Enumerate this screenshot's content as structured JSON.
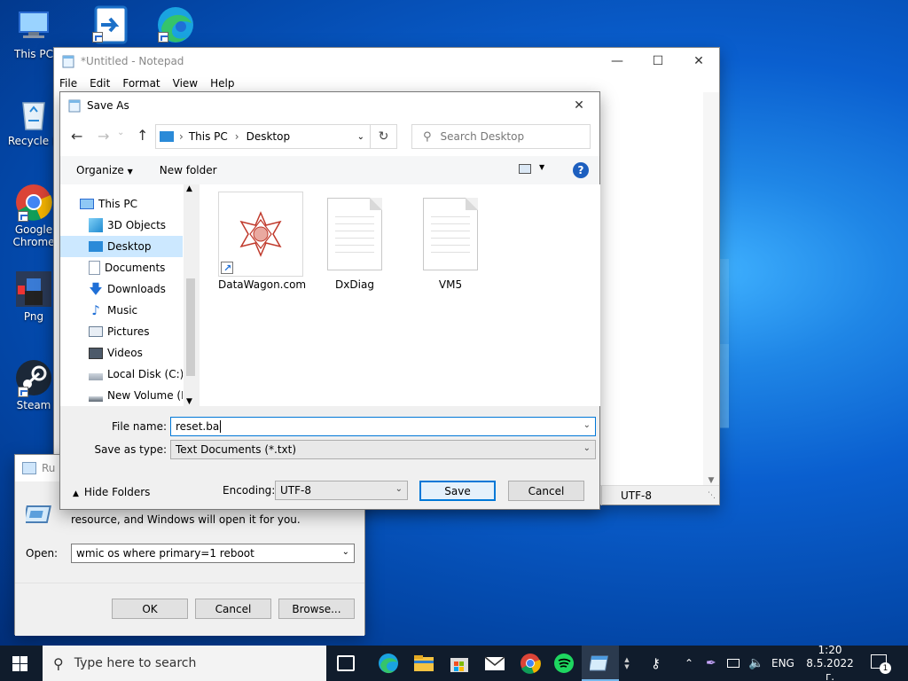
{
  "desktop": {
    "icons": [
      {
        "label": "This PC"
      },
      {
        "label": "Recycle B"
      },
      {
        "label": "Google Chrome"
      },
      {
        "label": "Png"
      },
      {
        "label": "Steam"
      }
    ]
  },
  "notepad": {
    "title": "*Untitled - Notepad",
    "menu": [
      "File",
      "Edit",
      "Format",
      "View",
      "Help"
    ],
    "status_encoding": "UTF-8"
  },
  "run": {
    "title": "Ru",
    "description": "resource, and Windows will open it for you.",
    "open_label": "Open:",
    "open_value": "wmic os where primary=1 reboot",
    "ok": "OK",
    "cancel": "Cancel",
    "browse": "Browse..."
  },
  "saveas": {
    "title": "Save As",
    "breadcrumb": [
      "This PC",
      "Desktop"
    ],
    "search_placeholder": "Search Desktop",
    "organize": "Organize",
    "new_folder": "New folder",
    "nav": [
      {
        "label": "This PC"
      },
      {
        "label": "3D Objects"
      },
      {
        "label": "Desktop"
      },
      {
        "label": "Documents"
      },
      {
        "label": "Downloads"
      },
      {
        "label": "Music"
      },
      {
        "label": "Pictures"
      },
      {
        "label": "Videos"
      },
      {
        "label": "Local Disk (C:)"
      },
      {
        "label": "New Volume (D:"
      }
    ],
    "files": [
      {
        "name": "DataWagon.com"
      },
      {
        "name": "DxDiag"
      },
      {
        "name": "VM5"
      }
    ],
    "file_name_label": "File name:",
    "file_name_value": "reset.ba",
    "save_type_label": "Save as type:",
    "save_type_value": "Text Documents (*.txt)",
    "hide_folders": "Hide Folders",
    "encoding_label": "Encoding:",
    "encoding_value": "UTF-8",
    "save": "Save",
    "cancel": "Cancel"
  },
  "taskbar": {
    "search_placeholder": "Type here to search",
    "lang": "ENG",
    "time": "1:20",
    "date": "8.5.2022 г.",
    "notif_count": "1"
  },
  "colors": {
    "accent": "#0078d7",
    "selection": "#cce8ff",
    "taskbar": "#101c2c"
  }
}
